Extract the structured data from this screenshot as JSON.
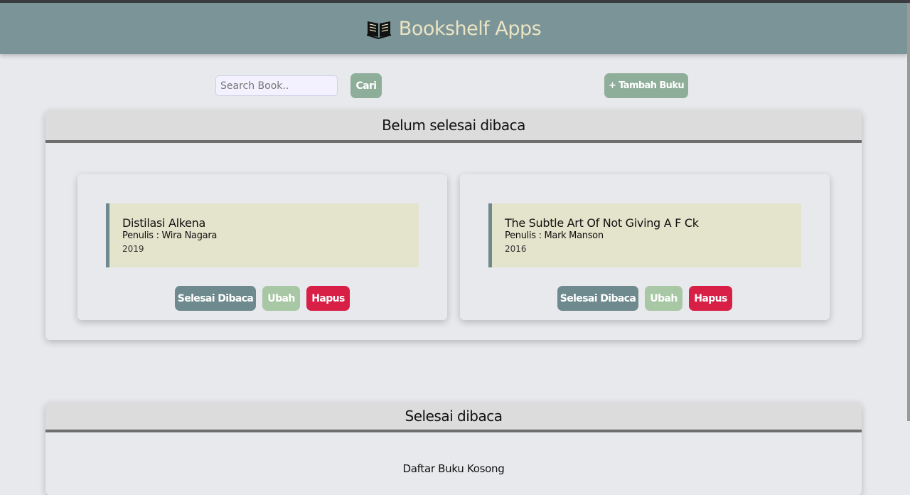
{
  "header": {
    "title": "Bookshelf Apps",
    "logo_icon": "open-book-icon"
  },
  "search": {
    "placeholder": "Search Book..",
    "value": "",
    "button_label": "Cari"
  },
  "add_button_label": "+ Tambah Buku",
  "unfinished_shelf": {
    "title": "Belum selesai dibaca",
    "books": [
      {
        "title": "Distilasi Alkena",
        "author": "Penulis : Wira Nagara",
        "year": "2019"
      },
      {
        "title": "The Subtle Art Of Not Giving A F Ck",
        "author": "Penulis : Mark Manson",
        "year": "2016"
      }
    ],
    "actions": {
      "finish": "Selesai Dibaca",
      "edit": "Ubah",
      "delete": "Hapus"
    }
  },
  "finished_shelf": {
    "title": "Selesai dibaca",
    "empty_text": "Daftar Buku Kosong"
  },
  "colors": {
    "header_bg": "#7a9498",
    "header_text": "#ebe4c3",
    "accent_green": "#8fae99",
    "finish_btn": "#6f8a8e",
    "edit_btn": "#a8c8a5",
    "delete_btn": "#d81f46",
    "book_bg": "#e4e3cb"
  }
}
